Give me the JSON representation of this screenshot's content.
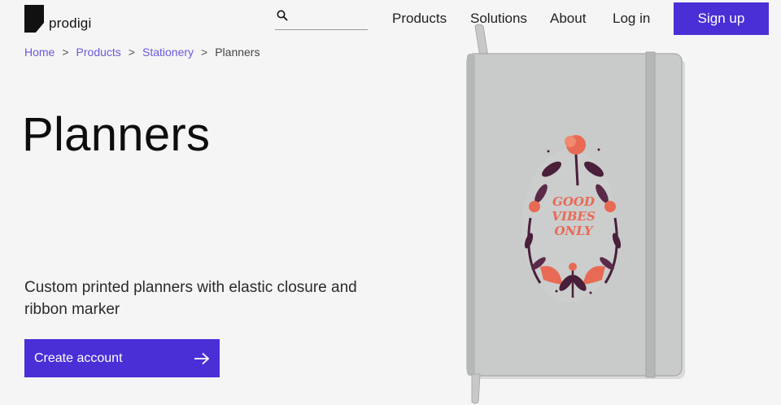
{
  "header": {
    "logo_text": "prodigi",
    "search": {
      "value": "",
      "placeholder": ""
    },
    "nav": {
      "products": "Products",
      "solutions": "Solutions",
      "about": "About",
      "login": "Log in"
    },
    "signup_label": "Sign up"
  },
  "breadcrumb": {
    "items": [
      "Home",
      "Products",
      "Stationery"
    ],
    "separator": ">",
    "current": "Planners"
  },
  "hero": {
    "title": "Planners",
    "subtitle": "Custom printed planners with elastic closure and ribbon marker",
    "cta_label": "Create account"
  },
  "product_image": {
    "cover_text_lines": [
      "GOOD",
      "VIBES",
      "ONLY"
    ]
  },
  "colors": {
    "brand": "#4a2fd6",
    "link": "#6a5ad9",
    "background": "#f5f5f5"
  },
  "icons": [
    "search-icon",
    "arrow-right-icon",
    "prodigi-logo-icon"
  ]
}
